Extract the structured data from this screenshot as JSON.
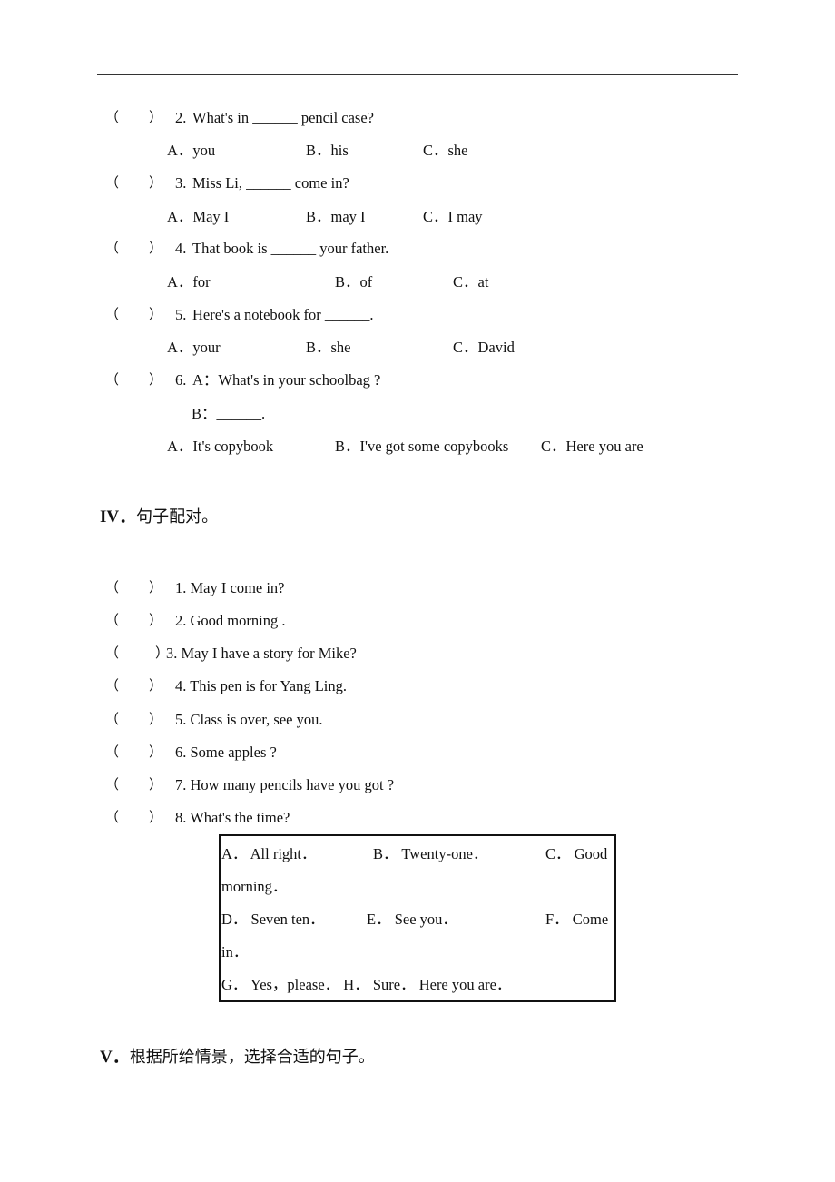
{
  "section3": {
    "questions": [
      {
        "num": "2.",
        "text": "What's in ______ pencil case?",
        "options": [
          "A．you",
          "B．his",
          "C．she"
        ]
      },
      {
        "num": "3.",
        "text": "Miss Li, ______ come in?",
        "options": [
          "A．May I",
          "B．may I",
          "C．I may"
        ]
      },
      {
        "num": "4.",
        "text": "That book is ______ your father.",
        "options": [
          "A．for",
          "B．of",
          "C．at"
        ]
      },
      {
        "num": "5.",
        "text": "Here's a notebook for ______.",
        "options": [
          "A．your",
          "B．she",
          "C．David"
        ]
      },
      {
        "num": "6.",
        "text": "A：What's in your schoolbag ?",
        "line2": "B：______.",
        "options": [
          "A．It's copybook",
          "B．I've got some copybooks",
          "C．Here you are"
        ]
      }
    ]
  },
  "section4": {
    "title_num": "IV．",
    "title_cn": "句子配对。",
    "items": [
      "1. May I come in?",
      "2. Good morning .",
      "3. May I have a story for Mike?",
      "4. This pen is for Yang Ling.",
      "5. Class is over, see you.",
      "6. Some apples ?",
      "7. How many pencils have you got ?",
      "8. What's the time?"
    ],
    "answers": {
      "row1": [
        "A． All right．",
        "B． Twenty-one．",
        "C． Good"
      ],
      "row1b": "morning．",
      "row2": [
        "D． Seven ten．",
        "E． See you．",
        "F． Come"
      ],
      "row2b": "in．",
      "row3": "G． Yes，please．  H． Sure． Here you are．"
    }
  },
  "section5": {
    "title_num": "V．",
    "title_cn": "根据所给情景，选择合适的句子。"
  },
  "bracket_open": "（",
  "bracket_close": "）"
}
